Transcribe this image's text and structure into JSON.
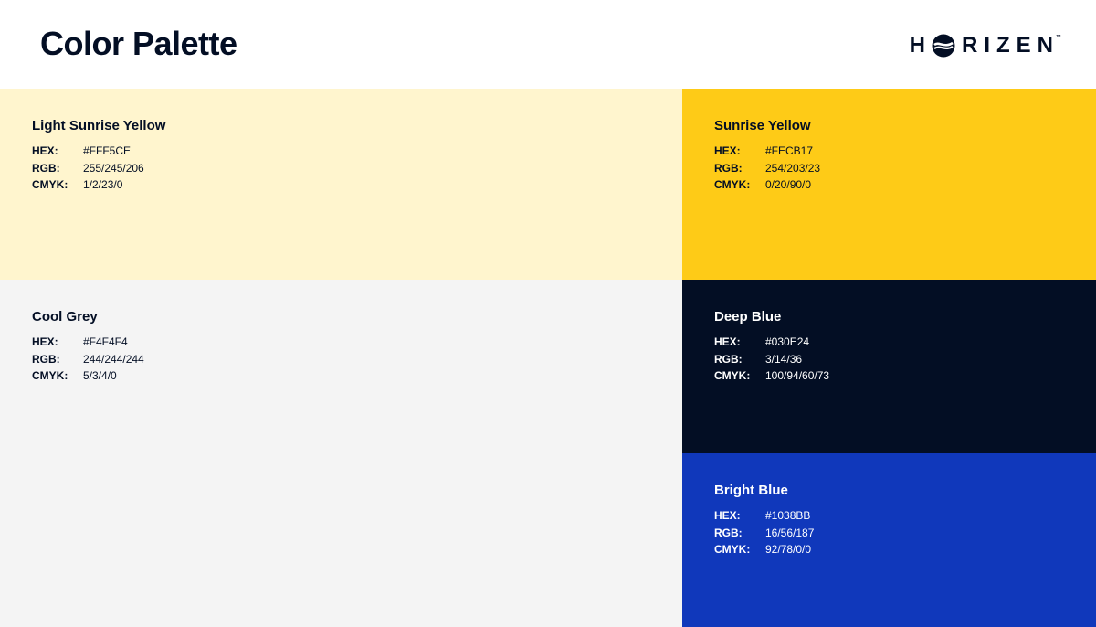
{
  "header": {
    "title": "Color Palette",
    "logo": {
      "left": "H",
      "right": "RIZEN",
      "tm": "™",
      "icon": "horizen-o-icon"
    }
  },
  "labels": {
    "hex": "HEX:",
    "rgb": "RGB:",
    "cmyk": "CMYK:"
  },
  "swatches": [
    {
      "name": "Light Sunrise Yellow",
      "hex": "#FFF5CE",
      "rgb": "255/245/206",
      "cmyk": "1/2/23/0",
      "bg": "#FFF5CE",
      "fg": "#030E24"
    },
    {
      "name": "Sunrise Yellow",
      "hex": "#FECB17",
      "rgb": "254/203/23",
      "cmyk": "0/20/90/0",
      "bg": "#FECB17",
      "fg": "#030E24"
    },
    {
      "name": "Cool Grey",
      "hex": "#F4F4F4",
      "rgb": "244/244/244",
      "cmyk": "5/3/4/0",
      "bg": "#F4F4F4",
      "fg": "#030E24"
    },
    {
      "name": "Deep Blue",
      "hex": "#030E24",
      "rgb": "3/14/36",
      "cmyk": "100/94/60/73",
      "bg": "#030E24",
      "fg": "#FFFFFF"
    },
    {
      "name": "Bright Blue",
      "hex": "#1038BB",
      "rgb": "16/56/187",
      "cmyk": "92/78/0/0",
      "bg": "#1038BB",
      "fg": "#FFFFFF"
    }
  ]
}
